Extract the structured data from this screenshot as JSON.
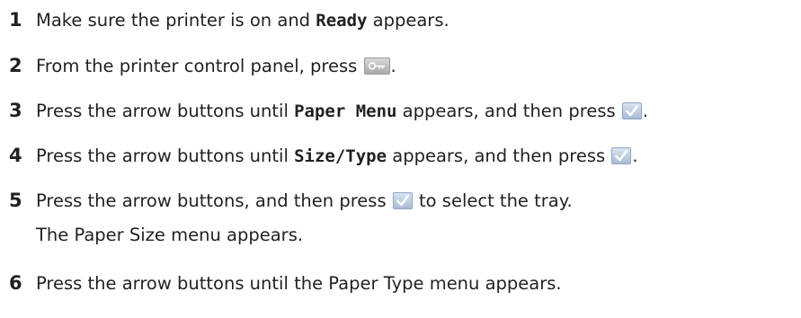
{
  "steps": [
    {
      "number": "1",
      "pre": "Make sure the printer is on and ",
      "code": "Ready",
      "post": " appears."
    },
    {
      "number": "2",
      "pre": "From the printer control panel, press ",
      "post": "."
    },
    {
      "number": "3",
      "pre": "Press the arrow buttons until ",
      "code": "Paper Menu",
      "mid": " appears, and then press ",
      "post": "."
    },
    {
      "number": "4",
      "pre": "Press the arrow buttons until ",
      "code": "Size/Type",
      "mid": " appears, and then press ",
      "post": "."
    },
    {
      "number": "5",
      "pre": "Press the arrow buttons, and then press ",
      "post": " to select the tray.",
      "note": "The Paper Size menu appears."
    },
    {
      "number": "6",
      "text": "Press the arrow buttons until the Paper Type menu appears."
    }
  ],
  "icons": {
    "menu_key": "key-icon",
    "select": "checkmark-icon"
  }
}
